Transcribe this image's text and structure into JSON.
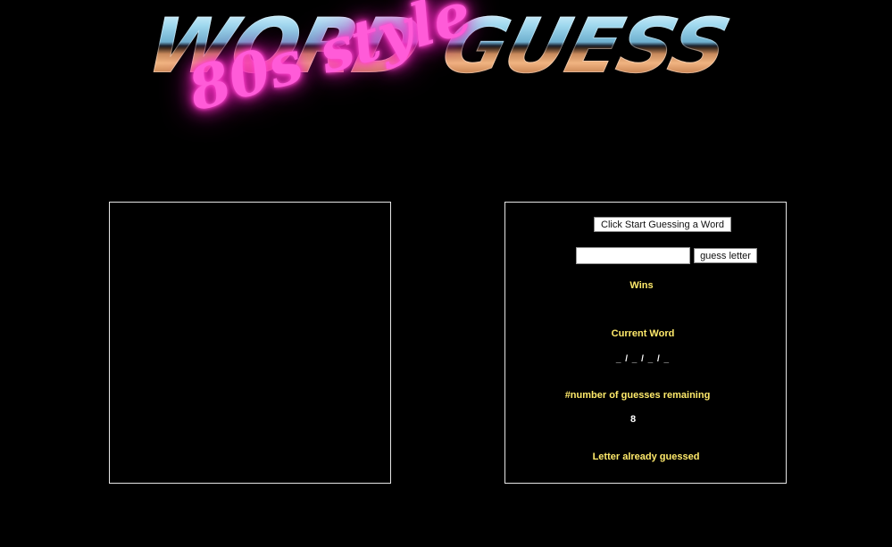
{
  "logo": {
    "title": "WORD GUESS",
    "subtitle": "80s style"
  },
  "controls": {
    "start_label": "Click Start Guessing a Word",
    "letter_input_value": "",
    "guess_label": "guess letter"
  },
  "stats": {
    "wins_label": "Wins",
    "wins_value": "",
    "current_word_label": "Current Word",
    "current_word_value": "_ / _ / _ / _",
    "guesses_remaining_label": "#number of guesses remaining",
    "guesses_remaining_value": "8",
    "letters_guessed_label": "Letter already guessed",
    "letters_guessed_value": ""
  },
  "colors": {
    "background": "#000000",
    "label_yellow": "#ffea6b",
    "neon_pink": "#ff5bd8",
    "panel_border": "#e6e6e6"
  }
}
